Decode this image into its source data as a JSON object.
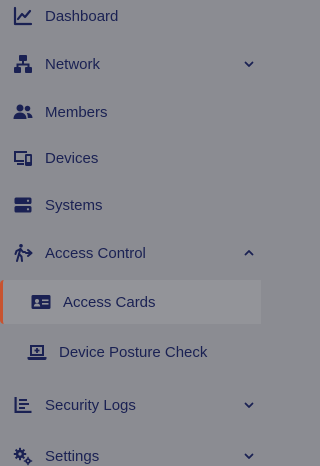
{
  "sidebar": {
    "items": [
      {
        "label": "Dashboard",
        "icon": "chart-line-icon"
      },
      {
        "label": "Network",
        "icon": "network-icon",
        "chevron": "down"
      },
      {
        "label": "Members",
        "icon": "users-icon"
      },
      {
        "label": "Devices",
        "icon": "devices-icon"
      },
      {
        "label": "Systems",
        "icon": "server-icon"
      },
      {
        "label": "Access Control",
        "icon": "walking-person-icon",
        "chevron": "up"
      },
      {
        "label": "Security Logs",
        "icon": "logs-icon",
        "chevron": "down"
      },
      {
        "label": "Settings",
        "icon": "gears-icon",
        "chevron": "down"
      }
    ],
    "access_control_children": [
      {
        "label": "Access Cards",
        "icon": "id-card-icon",
        "active": true
      },
      {
        "label": "Device Posture Check",
        "icon": "laptop-plus-icon",
        "active": false
      }
    ]
  },
  "colors": {
    "background": "#8b8c92",
    "text": "#1a2153",
    "active_indicator": "#c8532f",
    "active_background": "#939499"
  }
}
